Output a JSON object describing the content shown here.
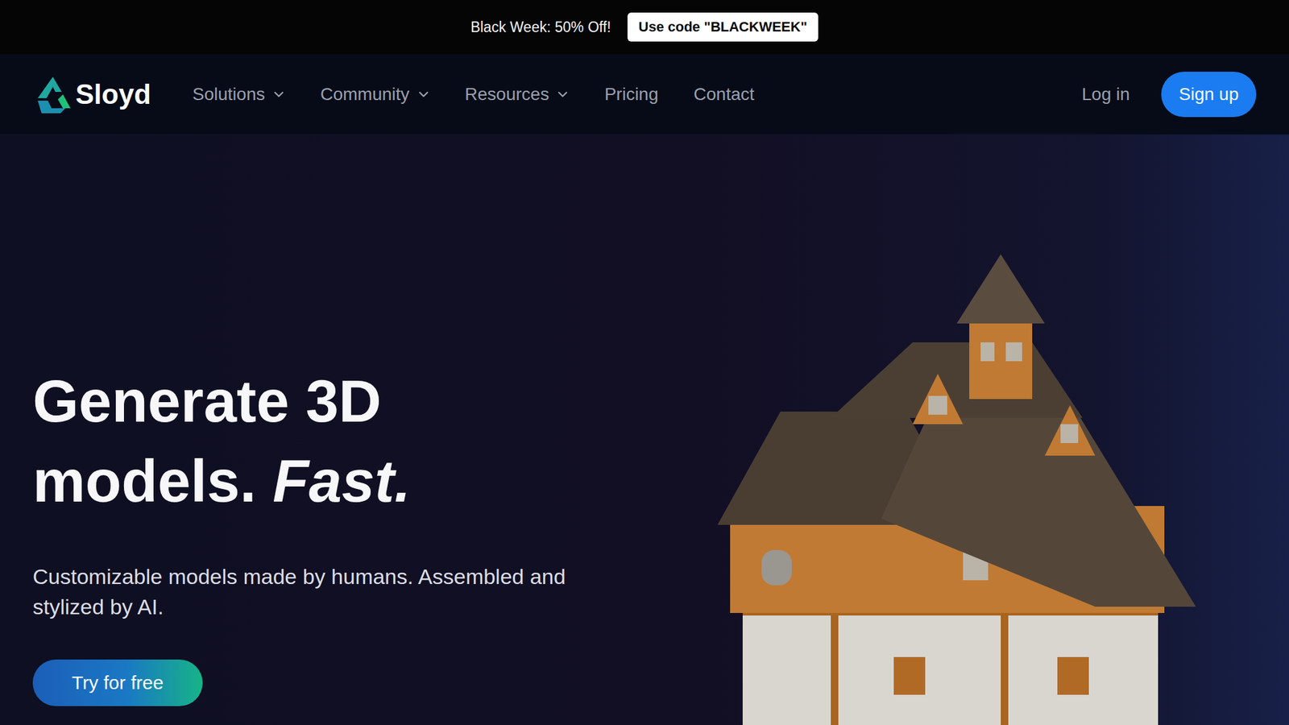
{
  "promo": {
    "text": "Black Week: 50% Off!",
    "code": "Use code \"BLACKWEEK\""
  },
  "logo": "Sloyd",
  "nav": [
    {
      "label": "Solutions",
      "kind": "dropdown"
    },
    {
      "label": "Community",
      "kind": "dropdown"
    },
    {
      "label": "Resources",
      "kind": "dropdown"
    },
    {
      "label": "Pricing",
      "kind": "link"
    },
    {
      "label": "Contact",
      "kind": "link"
    }
  ],
  "auth": {
    "login": "Log in",
    "signup": "Sign up"
  },
  "hero": {
    "title_line1": "Generate 3D",
    "title_line2": "models.",
    "title_emphasis": "Fast.",
    "subtitle": "Customizable models made by humans. Assembled and stylized by AI.",
    "cta": "Try for free"
  }
}
